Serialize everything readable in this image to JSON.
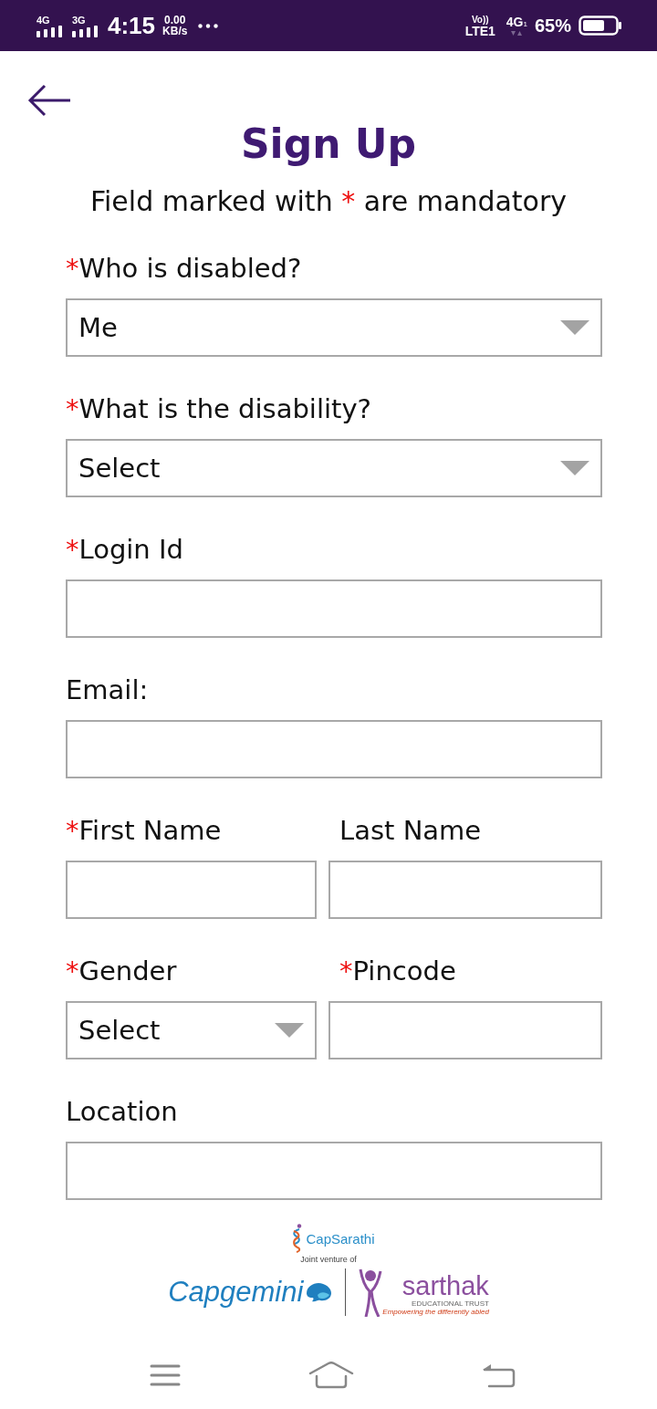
{
  "status_bar": {
    "signals": [
      {
        "network": "4G"
      },
      {
        "network": "3G"
      }
    ],
    "time": "4:15",
    "speed": "0.00",
    "speed_unit": "KB/s",
    "volte": "Vo))",
    "line": "LTE1",
    "data_network": "4G",
    "data_sim": "1",
    "battery": "65%"
  },
  "header": {
    "title": "Sign Up",
    "note": {
      "before": "Field marked with",
      "mark": "*",
      "after": "are mandatory"
    }
  },
  "form": {
    "rows": [
      {
        "fields": [
          {
            "label": "Who is disabled?",
            "required_mark": "*",
            "kind": "select",
            "value": "Me"
          }
        ]
      },
      {
        "fields": [
          {
            "label": "What is the disability?",
            "required_mark": "*",
            "kind": "select",
            "value": "Select"
          }
        ]
      },
      {
        "fields": [
          {
            "label": "Login Id",
            "required_mark": "*",
            "kind": "text"
          }
        ]
      },
      {
        "fields": [
          {
            "label": "Email:",
            "kind": "text"
          }
        ]
      },
      {
        "fields": [
          {
            "label": "First Name",
            "required_mark": "*",
            "kind": "text"
          },
          {
            "label": "Last Name",
            "kind": "text"
          }
        ]
      },
      {
        "fields": [
          {
            "label": "Gender",
            "required_mark": "*",
            "kind": "select",
            "value": "Select"
          },
          {
            "label": "Pincode",
            "required_mark": "*",
            "kind": "text"
          }
        ]
      },
      {
        "fields": [
          {
            "label": "Location",
            "kind": "text"
          }
        ]
      }
    ]
  },
  "footer": {
    "brand": "CapSarathi",
    "caption": "Joint venture of",
    "partner_left": {
      "name": "Capgemini"
    },
    "partner_right": {
      "name": "sarthak",
      "subtitle": "EDUCATIONAL TRUST",
      "slogan": "Empowering the differently abled"
    }
  }
}
